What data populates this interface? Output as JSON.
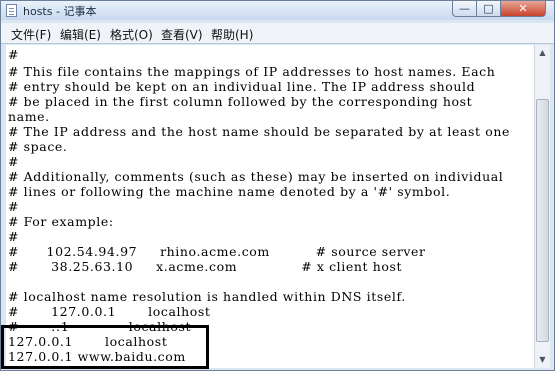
{
  "window": {
    "title": "hosts - 记事本"
  },
  "controls": {
    "minimize": "—",
    "maximize": "□",
    "close": "✕"
  },
  "menu": [
    "文件(F)",
    "编辑(E)",
    "格式(O)",
    "查看(V)",
    "帮助(H)"
  ],
  "lines": [
    "#",
    "# This file contains the mappings of IP addresses to host names. Each",
    "# entry should be kept on an individual line. The IP address should",
    "# be placed in the first column followed by the corresponding host",
    "name.",
    "# The IP address and the host name should be separated by at least one",
    "# space.",
    "#",
    "# Additionally, comments (such as these) may be inserted on individual",
    "# lines or following the machine name denoted by a '#' symbol.",
    "#",
    "# For example:",
    "#",
    "#      102.54.94.97     rhino.acme.com          # source server",
    "#       38.25.63.10     x.acme.com              # x client host",
    "",
    "# localhost name resolution is handled within DNS itself.",
    "#       127.0.0.1       localhost",
    "#       ::1             localhost",
    "127.0.0.1       localhost",
    "127.0.0.1 www.baidu.com"
  ],
  "scrollbar": {
    "up_arrow": "▲",
    "down_arrow": "▼"
  }
}
